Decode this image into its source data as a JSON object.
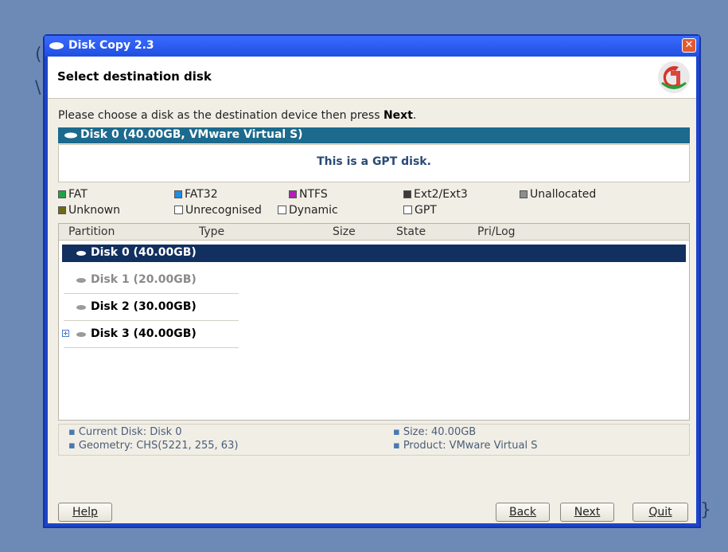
{
  "window": {
    "title": "Disk Copy 2.3",
    "close_glyph": "✕",
    "header_title": "Select destination disk",
    "logo_colors": [
      "#d8342a",
      "#2f9a3a",
      "#ffffff"
    ]
  },
  "instruction": {
    "prefix": "Please choose a disk as the destination device then press ",
    "emphasis": "Next",
    "suffix": "."
  },
  "selected_disk_bar": "Disk 0 (40.00GB, VMware Virtual S)",
  "gpt_message": "This is a GPT disk.",
  "legend": [
    {
      "label": "FAT",
      "color": "#1fa34a",
      "kind": "swatch"
    },
    {
      "label": "FAT32",
      "color": "#1f8ee0",
      "kind": "swatch"
    },
    {
      "label": "NTFS",
      "color": "#b21fb8",
      "kind": "swatch"
    },
    {
      "label": "Ext2/Ext3",
      "color": "#3b3b3b",
      "kind": "swatch"
    },
    {
      "label": "Unallocated",
      "color": "#8e8e8e",
      "kind": "swatch"
    },
    {
      "label": "Unknown",
      "color": "#6e6a12",
      "kind": "swatch"
    },
    {
      "label": "Unrecognised",
      "kind": "checkbox"
    },
    {
      "label": "Dynamic",
      "kind": "checkbox"
    },
    {
      "label": "GPT",
      "kind": "checkbox"
    }
  ],
  "table": {
    "columns": [
      "Partition",
      "Type",
      "Size",
      "State",
      "Pri/Log"
    ],
    "rows": [
      {
        "label": "Disk 0 (40.00GB)",
        "selected": true,
        "dim": false,
        "expander": false
      },
      {
        "label": "Disk 1 (20.00GB)",
        "selected": false,
        "dim": true,
        "expander": false
      },
      {
        "label": "Disk 2 (30.00GB)",
        "selected": false,
        "dim": false,
        "expander": false
      },
      {
        "label": "Disk 3 (40.00GB)",
        "selected": false,
        "dim": false,
        "expander": true
      }
    ]
  },
  "info": {
    "current_disk": "Current Disk: Disk 0",
    "geometry": "Geometry: CHS(5221, 255, 63)",
    "size": "Size: 40.00GB",
    "product": "Product: VMware Virtual S"
  },
  "buttons": {
    "help": "Help",
    "back": "Back",
    "next": "Next",
    "quit": "Quit"
  }
}
